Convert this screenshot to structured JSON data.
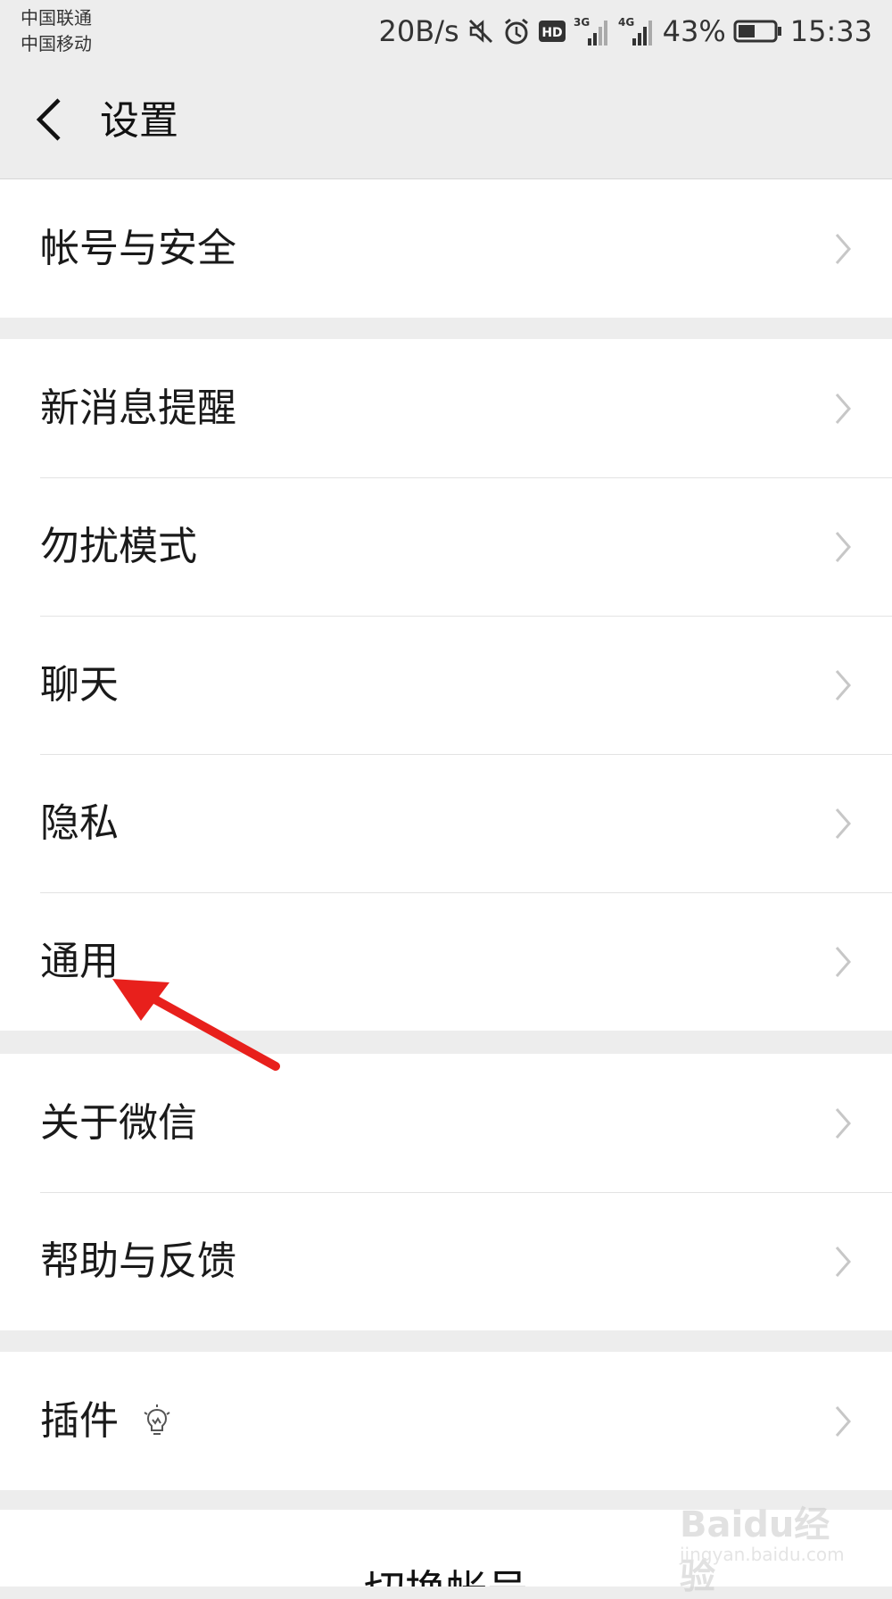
{
  "status_bar": {
    "carrier_1": "中国联通",
    "carrier_2": "中国移动",
    "speed": "20B/s",
    "net_1": "3G",
    "net_2": "4G",
    "battery": "43%",
    "time": "15:33",
    "hd": "HD"
  },
  "nav": {
    "title": "设置"
  },
  "groups": [
    {
      "items": [
        {
          "label": "帐号与安全"
        }
      ]
    },
    {
      "items": [
        {
          "label": "新消息提醒"
        },
        {
          "label": "勿扰模式"
        },
        {
          "label": "聊天"
        },
        {
          "label": "隐私"
        },
        {
          "label": "通用"
        }
      ]
    },
    {
      "items": [
        {
          "label": "关于微信"
        },
        {
          "label": "帮助与反馈"
        }
      ]
    },
    {
      "items": [
        {
          "label": "插件"
        }
      ]
    }
  ],
  "switch_account": {
    "label": "切换帐号"
  },
  "annotation": {
    "color": "#e8201c"
  },
  "watermark": {
    "brand": "Baidu经验",
    "url": "jingyan.baidu.com"
  }
}
